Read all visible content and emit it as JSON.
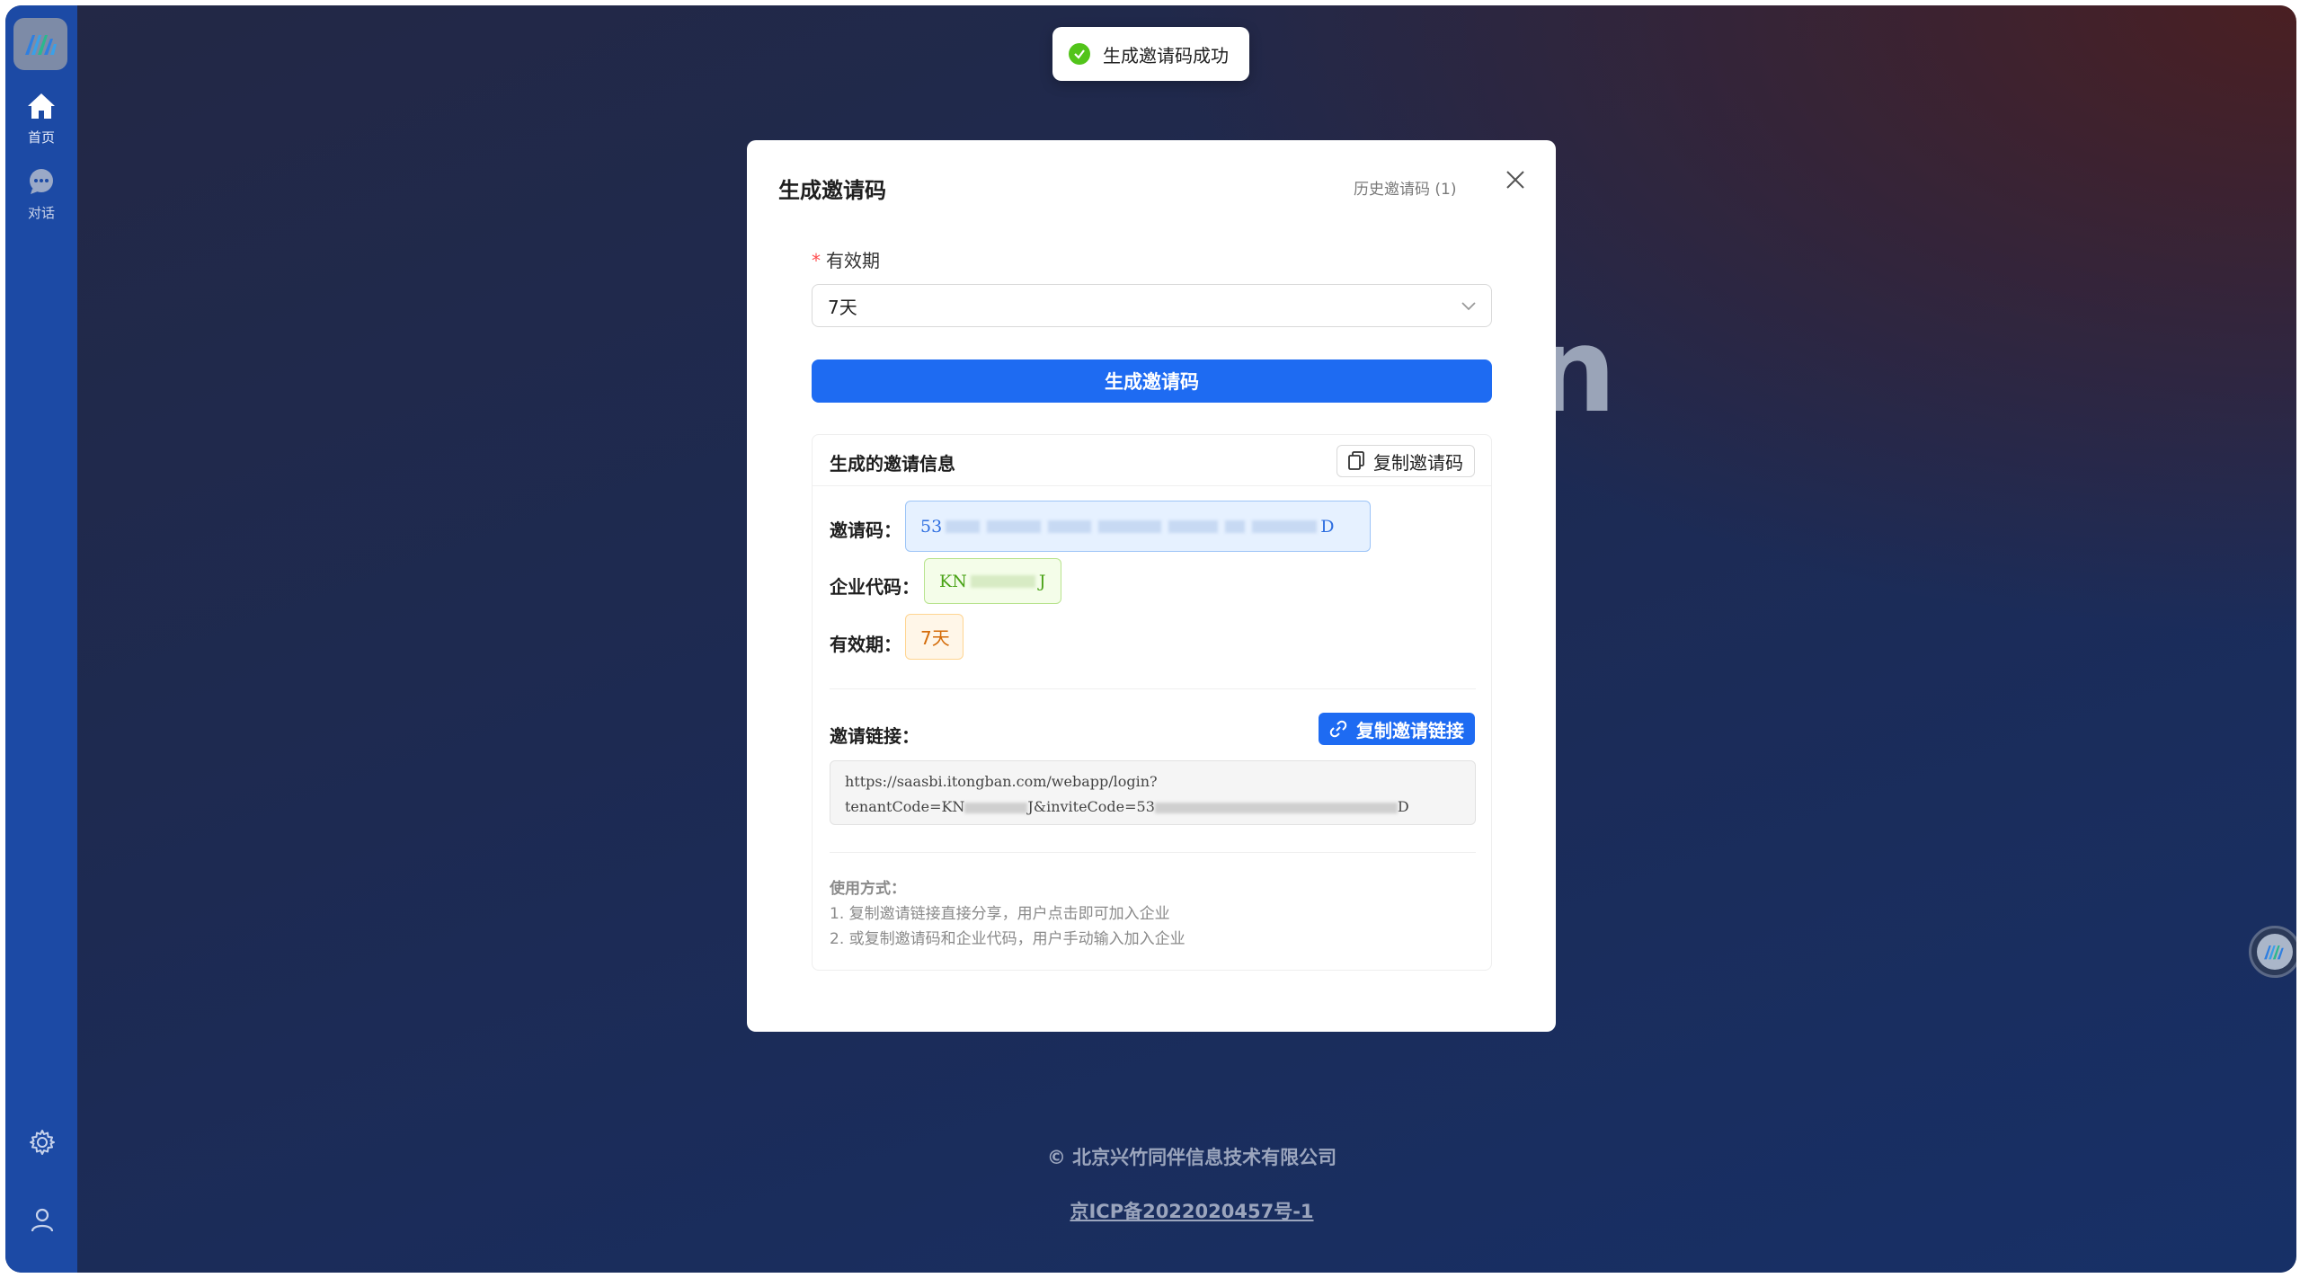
{
  "sidebar": {
    "items": [
      {
        "label": "首页",
        "icon": "home-icon"
      },
      {
        "label": "对话",
        "icon": "chat-icon"
      }
    ],
    "bottom_icons": [
      "settings-icon",
      "user-icon"
    ]
  },
  "background": {
    "watermark_letter": "n"
  },
  "toast": {
    "text": "生成邀请码成功",
    "icon": "check-circle-icon",
    "color": "#52c41a"
  },
  "modal": {
    "title": "生成邀请码",
    "history_link": "历史邀请码 (1)",
    "validity_field": {
      "label": "有效期",
      "required_mark": "*",
      "value": "7天"
    },
    "generate_button": "生成邀请码",
    "card": {
      "title": "生成的邀请信息",
      "copy_code_button": "复制邀请码",
      "invite_code": {
        "label": "邀请码：",
        "prefix": "53",
        "suffix": "D"
      },
      "enterprise_code": {
        "label": "企业代码：",
        "prefix": "KN",
        "suffix": "J"
      },
      "validity": {
        "label": "有效期：",
        "value": "7天"
      },
      "invite_link": {
        "label": "邀请链接：",
        "copy_button": "复制邀请链接",
        "line1": "https://saasbi.itongban.com/webapp/login?",
        "line2_a": "tenantCode=KN",
        "line2_b": "J&inviteCode=53",
        "line2_c": "D"
      },
      "usage": {
        "title": "使用方式：",
        "lines": [
          "1. 复制邀请链接直接分享，用户点击即可加入企业",
          "2. 或复制邀请码和企业代码，用户手动输入加入企业"
        ]
      }
    }
  },
  "footer": {
    "copyright": "© 北京兴竹同伴信息技术有限公司",
    "icp": "京ICP备2022020457号-1"
  },
  "colors": {
    "primary": "#1e6bf2",
    "sidebar": "#1c4aa5"
  }
}
